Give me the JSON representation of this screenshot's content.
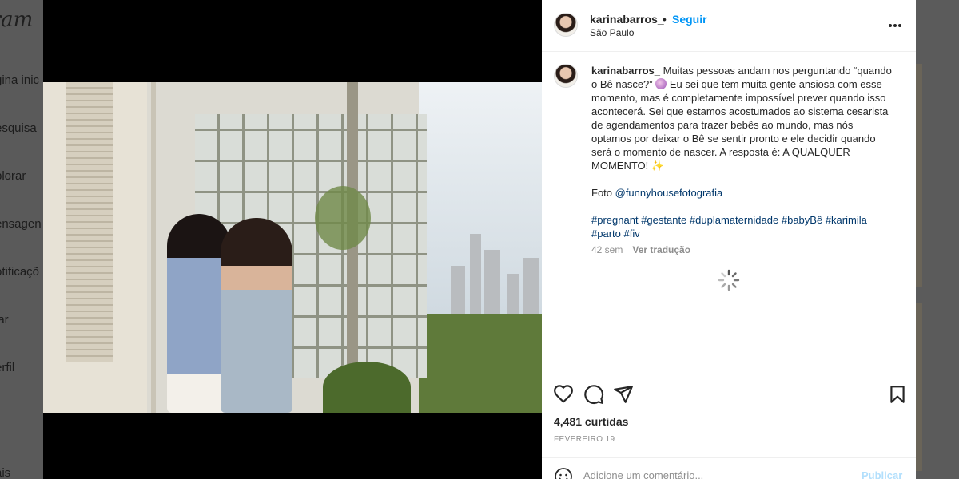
{
  "background": {
    "logo": "gram",
    "nav": [
      "gina inic",
      "esquisa",
      "plorar",
      "ensagen",
      "otificaçõ",
      "iar",
      "erfil",
      "ais"
    ]
  },
  "post": {
    "username": "karinabarros_",
    "separator": "•",
    "follow_label": "Seguir",
    "location": "São Paulo",
    "more_icon": "more-horizontal-icon",
    "caption": {
      "username": "karinabarros_",
      "text_part1": " Muitas pessoas andam nos perguntando “quando o Bê nasce?” ",
      "emoji1": "crystal-ball",
      "text_part2": " Eu sei que tem muita gente ansiosa com esse momento, mas é completamente impossível prever quando isso acontecerá. Sei que estamos acostumados ao sistema cesarista de agendamentos para trazer bebês ao mundo, mas nós optamos por deixar o Bê se sentir pronto e ele decidir quando será o momento de nascer. A resposta é: A QUALQUER MOMENTO! ",
      "emoji2": "✨",
      "photo_prefix": "Foto ",
      "photo_credit": "@funnyhousefotografia",
      "hashtags": [
        "#pregnant",
        "#gestante",
        "#duplamaternidade",
        "#babyBê",
        "#karimila",
        "#parto",
        "#fiv"
      ]
    },
    "time_ago": "42 sem",
    "translate_label": "Ver tradução",
    "likes": "4,481 curtidas",
    "date": "FEVEREIRO 19",
    "comment_placeholder": "Adicione um comentário...",
    "publish_label": "Publicar"
  },
  "colors": {
    "accent": "#0095f6",
    "publish_disabled": "#b2dffc",
    "text": "#262626",
    "muted": "#8e8e8e",
    "link": "#00376b"
  }
}
